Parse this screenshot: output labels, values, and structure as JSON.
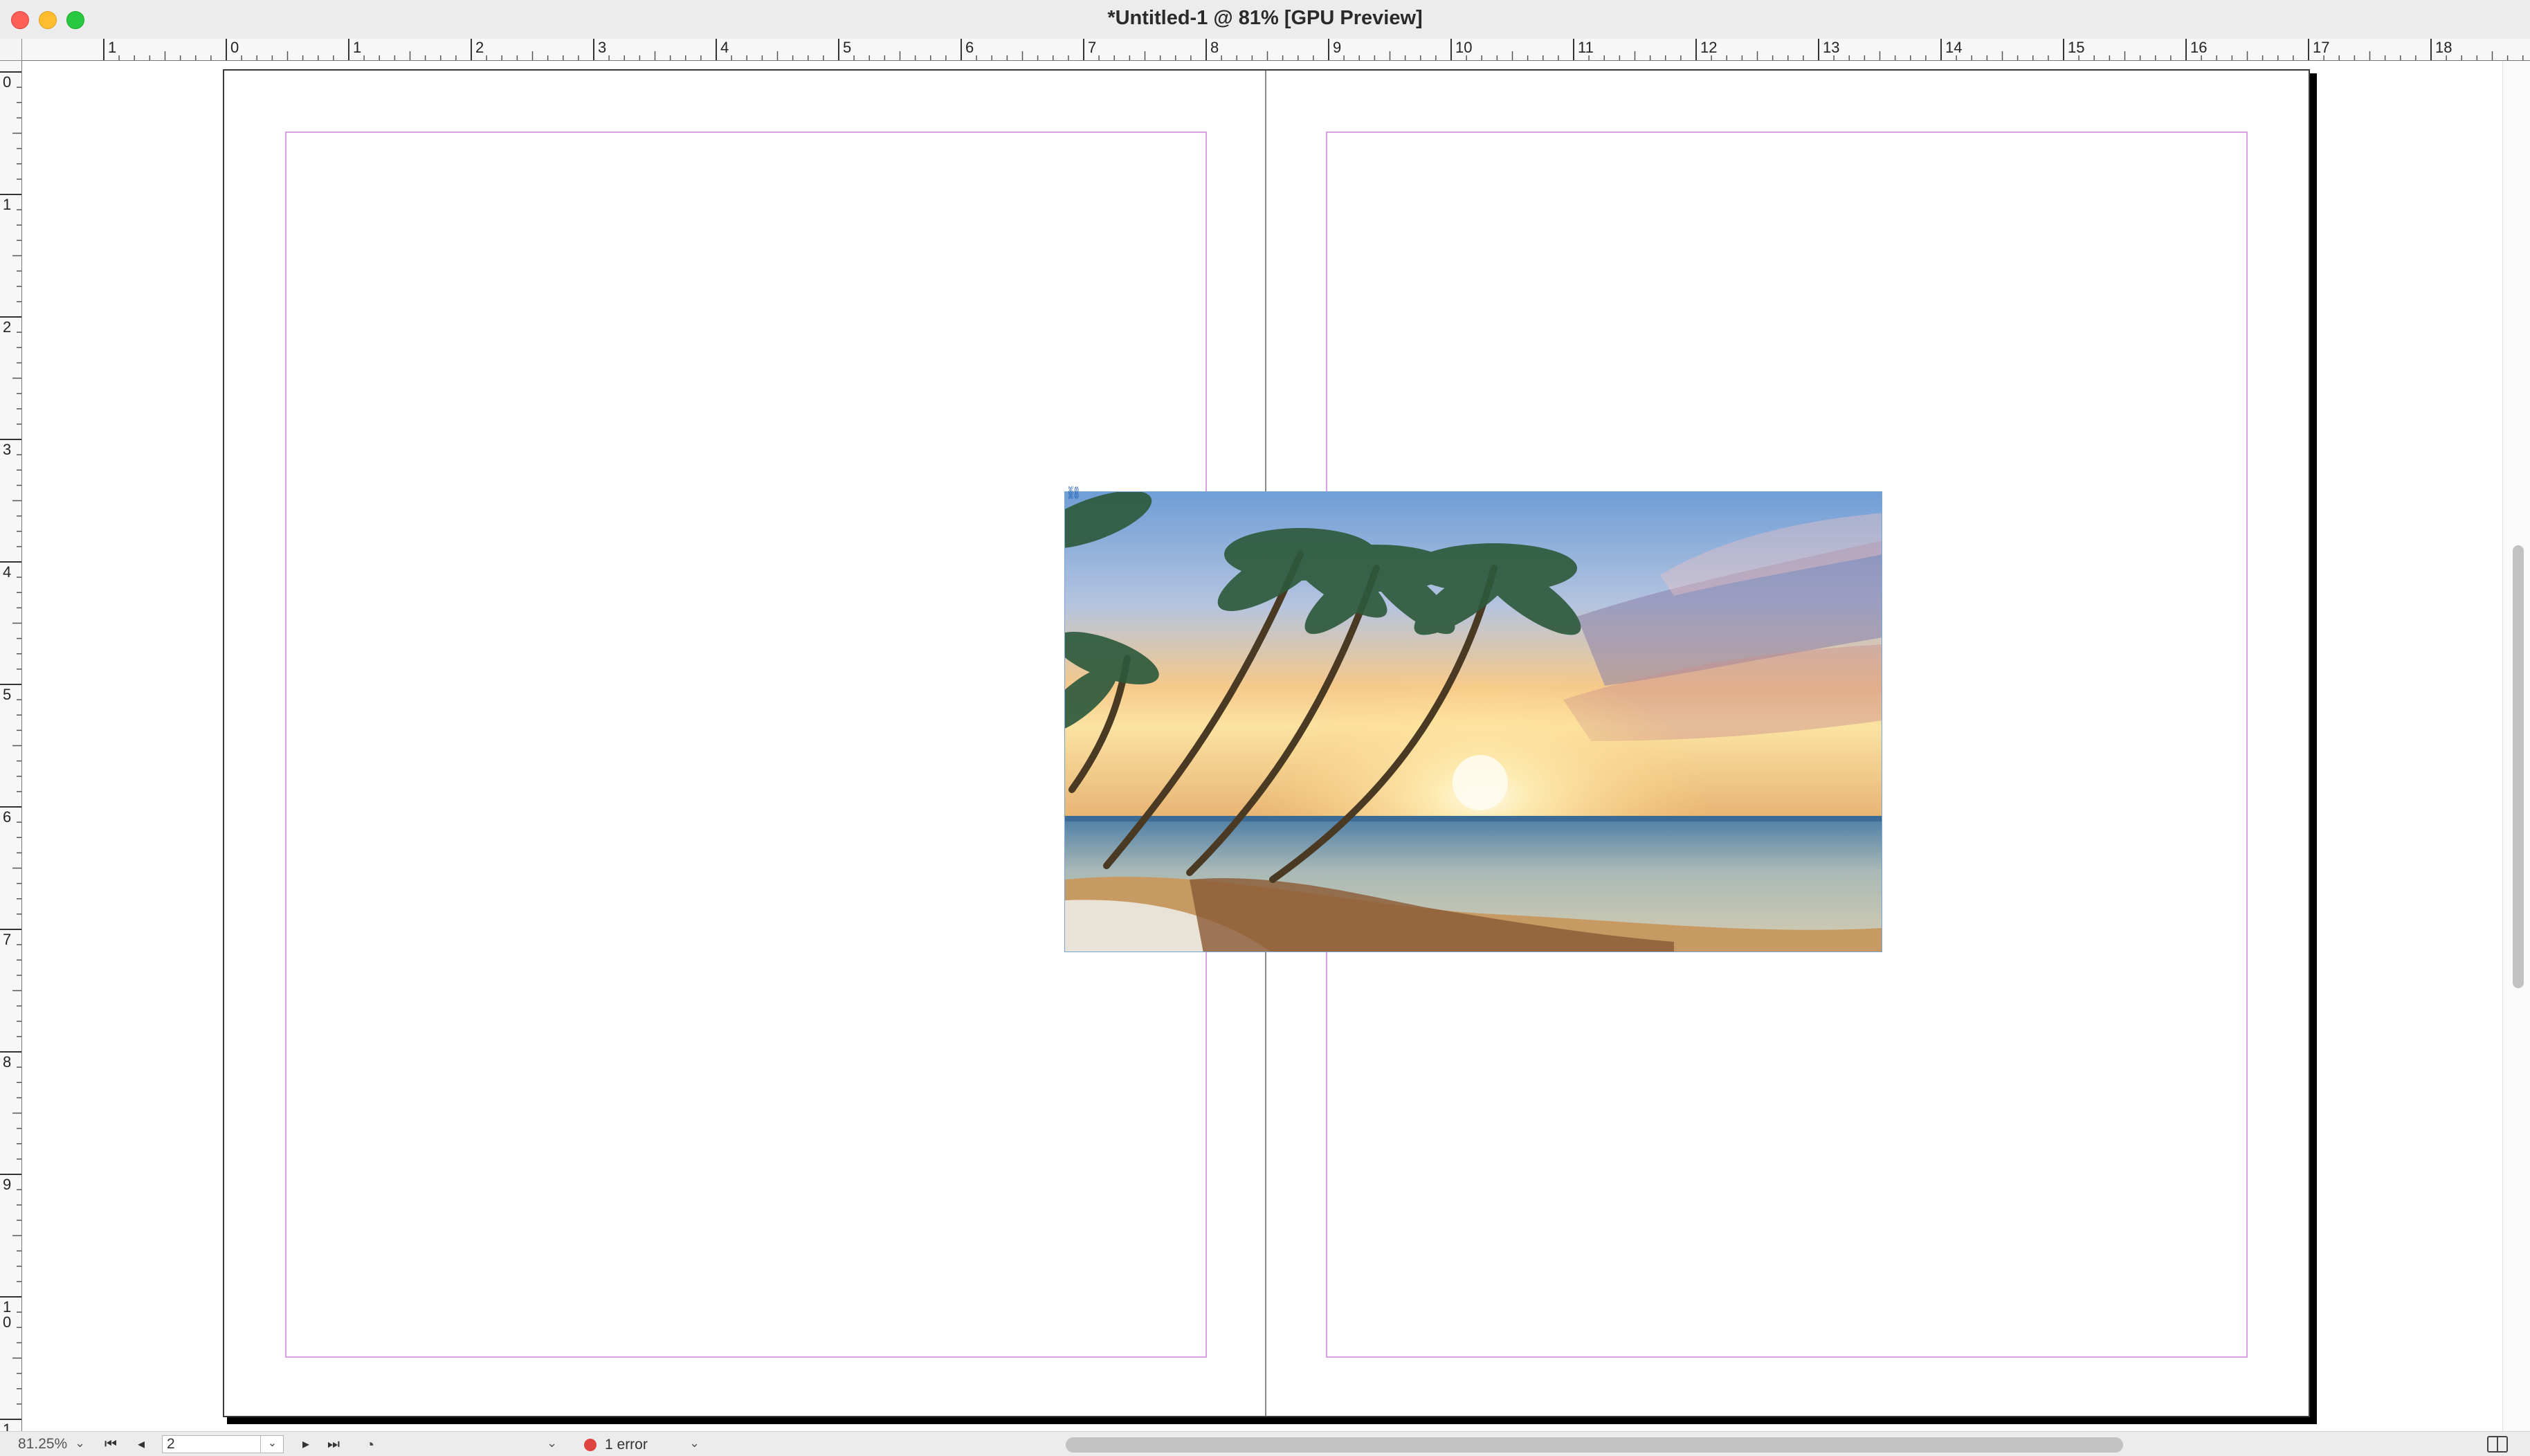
{
  "window": {
    "title": "*Untitled-1 @ 81% [GPU Preview]"
  },
  "rulers": {
    "horizontal_labels": [
      "1",
      "0",
      "1",
      "2",
      "3",
      "4",
      "5",
      "6",
      "7",
      "8",
      "9",
      "10",
      "11",
      "12",
      "13",
      "14",
      "15",
      "16",
      "17",
      "18"
    ],
    "vertical_labels": [
      "0",
      "1",
      "2",
      "3",
      "4",
      "5",
      "6",
      "7",
      "8",
      "9",
      "10",
      "1"
    ]
  },
  "document": {
    "spread_pages": 2,
    "placed_image": {
      "subject": "beach-sunset-palm-trees",
      "linked": true
    }
  },
  "status_bar": {
    "zoom": "81.25%",
    "page_number": "2",
    "preflight_status": "1 error",
    "error_color": "#e0443e"
  },
  "icons": {
    "first_page": "first-page-icon",
    "prev_page": "prev-page-icon",
    "next_page": "next-page-icon",
    "last_page": "last-page-icon",
    "preflight": "preflight-profile-icon",
    "link": "link-icon",
    "view_toggle": "split-view-icon"
  }
}
